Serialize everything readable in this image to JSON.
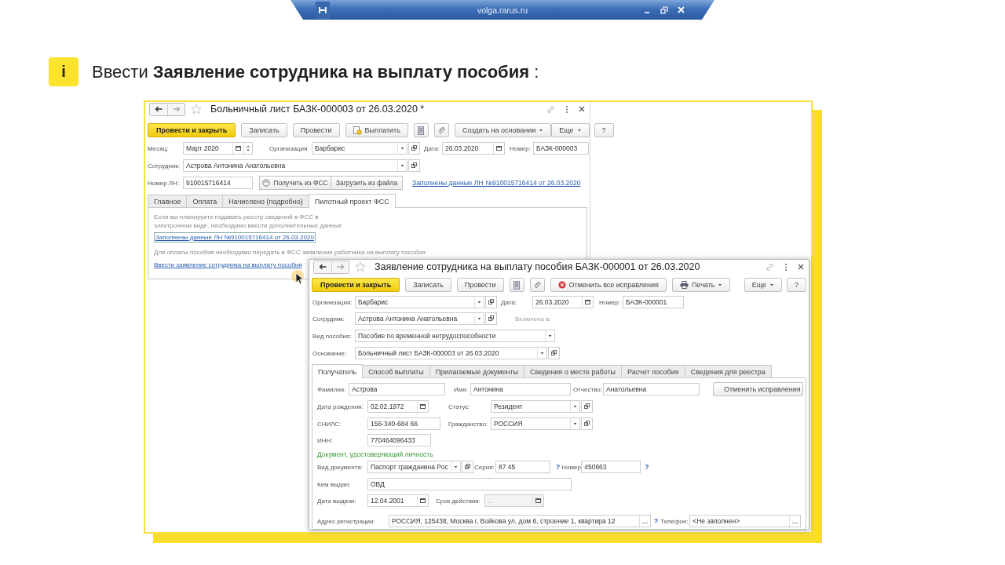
{
  "viewer_bar": {
    "title": "volga.rarus.ru"
  },
  "heading": {
    "badge": "i",
    "text": "Ввести **Заявление сотрудника на выплату пособия** :"
  },
  "windows": [
    {
      "title": "Больничный лист БАЗК-000003 от 26.03.2020 *",
      "toolbar": {
        "left": [
          {
            "kind": "primary",
            "label": "Провести и закрыть"
          },
          {
            "kind": "plain",
            "label": "Записать"
          },
          {
            "kind": "plain",
            "label": "Провести"
          },
          {
            "kind": "pay",
            "label": "Выплатить"
          },
          {
            "kind": "doc"
          },
          {
            "kind": "clip"
          },
          {
            "kind": "menu",
            "label": "Создать на основании"
          }
        ],
        "right": [
          {
            "kind": "menu",
            "label": "Еще"
          },
          {
            "kind": "plain",
            "label": "?"
          }
        ]
      },
      "rows": [
        {
          "items": [
            {
              "kind": "label",
              "text": "Месяц:"
            },
            {
              "kind": "month",
              "value": "Март 2020"
            },
            {
              "kind": "label",
              "text": "Организация:"
            },
            {
              "kind": "select",
              "value": "Барбарис",
              "open_button": true
            },
            {
              "kind": "label",
              "text": "Дата:"
            },
            {
              "kind": "date",
              "value": "26.03.2020"
            },
            {
              "kind": "label",
              "text": "Номер:"
            },
            {
              "kind": "input",
              "value": "БАЗК-000003"
            }
          ]
        },
        {
          "items": [
            {
              "kind": "label",
              "text": "Сотрудник:"
            },
            {
              "kind": "select",
              "value": "Астрова Антонина Анатольевна",
              "open_button": true
            }
          ]
        },
        {
          "items": [
            {
              "kind": "label",
              "text": "Номер ЛН:"
            },
            {
              "kind": "input",
              "value": "910015716414"
            },
            {
              "kind": "group",
              "buttons": [
                {
                  "kind": "fss",
                  "label": "Получить из ФСС"
                },
                {
                  "kind": "plain",
                  "label": "Загрузить из файла"
                }
              ]
            },
            {
              "kind": "link",
              "text": "Заполнены данные ЛН №910015716414 от 26.03.2020"
            }
          ]
        }
      ],
      "tabs": [
        {
          "label": "Главное",
          "selected": false
        },
        {
          "label": "Оплата",
          "selected": false
        },
        {
          "label": "Начислено (подробно)",
          "selected": false
        },
        {
          "label": "Пилотный проект ФСС",
          "selected": true
        }
      ],
      "panel": [
        {
          "items": [
            {
              "kind": "note",
              "text": "Если вы планируете подавать реестр сведений в ФСС в\nэлектронном виде, необходимо ввести дополнительные данные"
            }
          ]
        },
        {
          "items": [
            {
              "kind": "focused_link",
              "text": "Заполнены данные ЛН №910015716414 от 26.03.2020"
            }
          ]
        },
        {
          "items": [
            {
              "kind": "note",
              "text": "Для оплаты пособия необходимо передать в ФСС заявление работника на выплату пособия"
            }
          ]
        },
        {
          "items": [
            {
              "kind": "link",
              "text": "Ввести заявление сотрудника на выплату пособия"
            }
          ]
        }
      ]
    },
    {
      "title": "Заявление сотрудника на выплату пособия БАЗК-000001 от 26.03.2020",
      "toolbar": {
        "left": [
          {
            "kind": "primary",
            "label": "Провести и закрыть"
          },
          {
            "kind": "plain",
            "label": "Записать"
          },
          {
            "kind": "plain",
            "label": "Провести"
          },
          {
            "kind": "doc"
          },
          {
            "kind": "clip"
          },
          {
            "kind": "cancel",
            "label": "Отменить все исправления"
          },
          {
            "kind": "print",
            "label": "Печать"
          }
        ],
        "right": [
          {
            "kind": "menu",
            "label": "Еще"
          },
          {
            "kind": "plain",
            "label": "?"
          }
        ]
      },
      "rows": [
        {
          "items": [
            {
              "kind": "label",
              "text": "Организация:"
            },
            {
              "kind": "select",
              "value": "Барбарис",
              "open_button": true
            },
            {
              "kind": "label",
              "text": "Дата:"
            },
            {
              "kind": "date",
              "value": "26.03.2020"
            },
            {
              "kind": "label",
              "text": "Номер:"
            },
            {
              "kind": "input",
              "value": "БАЗК-000001"
            }
          ]
        },
        {
          "items": [
            {
              "kind": "label",
              "text": "Сотрудник:"
            },
            {
              "kind": "select",
              "value": "Астрова Антонина Анатольевна",
              "open_button": true
            },
            {
              "kind": "dim_label",
              "text": "Включена в:"
            }
          ]
        },
        {
          "items": [
            {
              "kind": "label",
              "text": "Вид пособия:"
            },
            {
              "kind": "select",
              "value": "Пособие по временной нетрудоспособности",
              "open_button": false
            }
          ]
        },
        {
          "items": [
            {
              "kind": "label",
              "text": "Основание:"
            },
            {
              "kind": "select",
              "value": "Больничный лист БАЗК-000003 от 26.03.2020",
              "open_button": true
            }
          ]
        }
      ],
      "tabs": [
        {
          "label": "Получатель",
          "selected": true
        },
        {
          "label": "Способ выплаты",
          "selected": false
        },
        {
          "label": "Прилагаемые документы",
          "selected": false
        },
        {
          "label": "Сведения о месте работы",
          "selected": false
        },
        {
          "label": "Расчет пособия",
          "selected": false
        },
        {
          "label": "Сведения для реестра",
          "selected": false
        }
      ],
      "panel": [
        {
          "items": [
            {
              "kind": "label",
              "text": "Фамилия:"
            },
            {
              "kind": "input",
              "value": "Астрова"
            },
            {
              "kind": "label",
              "text": "Имя:"
            },
            {
              "kind": "input",
              "value": "Антонина"
            },
            {
              "kind": "label",
              "text": "Отчество:"
            },
            {
              "kind": "input",
              "value": "Анатольевна"
            },
            {
              "kind": "cancel",
              "label": "Отменить исправления"
            }
          ]
        },
        {
          "items": [
            {
              "kind": "label",
              "text": "Дата рождения:"
            },
            {
              "kind": "date",
              "value": "02.02.1972"
            },
            {
              "kind": "label",
              "text": "Статус:"
            },
            {
              "kind": "select",
              "value": "Резидент",
              "open_button": true
            }
          ]
        },
        {
          "items": [
            {
              "kind": "label",
              "text": "СНИЛС:"
            },
            {
              "kind": "input",
              "value": "156-340-684 66"
            },
            {
              "kind": "label",
              "text": "Гражданство:"
            },
            {
              "kind": "select",
              "value": "РОССИЯ",
              "open_button": true
            }
          ]
        },
        {
          "items": [
            {
              "kind": "label",
              "text": "ИНН:"
            },
            {
              "kind": "input",
              "value": "770464096433"
            }
          ]
        },
        {
          "items": [
            {
              "kind": "section",
              "text": "Документ, удостоверяющий личность"
            }
          ]
        },
        {
          "items": [
            {
              "kind": "label",
              "text": "Вид документа:"
            },
            {
              "kind": "select",
              "value": "Паспорт гражданина Рос",
              "open_button": true
            },
            {
              "kind": "label",
              "text": "Серия:"
            },
            {
              "kind": "input",
              "value": "87 45"
            },
            {
              "kind": "help",
              "text": "?"
            },
            {
              "kind": "label",
              "text": "Номер:"
            },
            {
              "kind": "input",
              "value": "450663"
            },
            {
              "kind": "help",
              "text": "?"
            }
          ]
        },
        {
          "items": [
            {
              "kind": "label",
              "text": "Кем выдан:"
            },
            {
              "kind": "input",
              "value": "ОВД"
            }
          ]
        },
        {
          "items": [
            {
              "kind": "label",
              "text": "Дата выдачи:"
            },
            {
              "kind": "date",
              "value": "12.04.2001"
            },
            {
              "kind": "label",
              "text": "Срок действия:"
            },
            {
              "kind": "date_disabled",
              "placeholder": ". ."
            }
          ]
        },
        {
          "items": [
            {
              "kind": "label",
              "text": "Адрес регистрации:"
            },
            {
              "kind": "dots_input",
              "value": "РОССИЯ, 125438, Москва г, Войкова ул, дом 6, строение 1, квартира 12"
            },
            {
              "kind": "help",
              "text": "?"
            },
            {
              "kind": "label",
              "text": "Телефон:"
            },
            {
              "kind": "dots_input",
              "value": "<Не заполнен>"
            }
          ]
        }
      ]
    }
  ]
}
